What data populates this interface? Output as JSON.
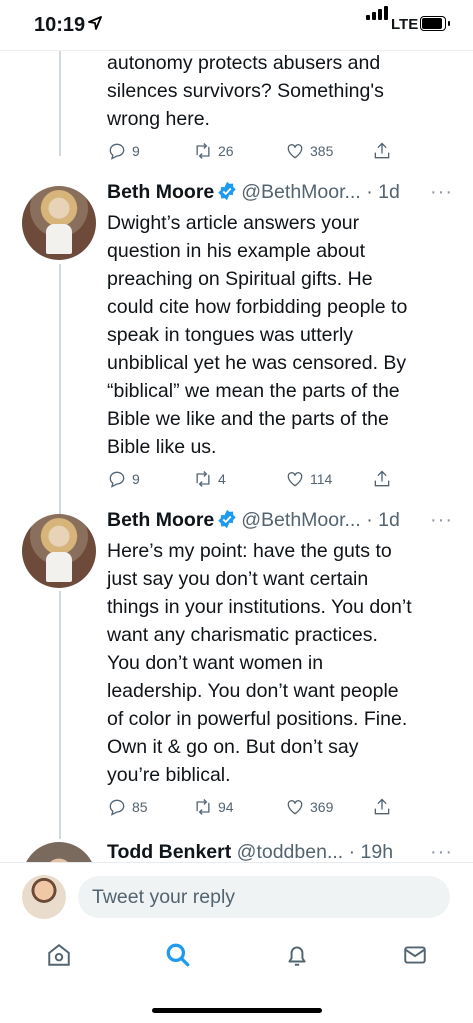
{
  "status_bar": {
    "time": "10:19",
    "network": "LTE"
  },
  "tweets": [
    {
      "text": "autonomy protects abusers and\nsilences survivors? Something's\nwrong here.",
      "replies": "9",
      "retweets": "26",
      "likes": "385"
    },
    {
      "name": "Beth Moore",
      "handle": "@BethMoor...",
      "time": "· 1d",
      "more": "···",
      "text": "Dwight’s article answers your\nquestion in his example about\npreaching on Spiritual gifts. He\ncould cite how forbidding people to\nspeak in tongues was utterly\nunbiblical yet he was censored. By\n“biblical” we mean the parts of the\nBible we like and the parts of the\nBible like us.",
      "replies": "9",
      "retweets": "4",
      "likes": "114"
    },
    {
      "name": "Beth Moore",
      "handle": "@BethMoor...",
      "time": "· 1d",
      "more": "···",
      "text": "Here’s my point: have the guts to\njust say you don’t want certain\nthings in your institutions. You don’t\nwant any charismatic practices.\nYou don’t want women in\nleadership. You don’t want people\nof color in powerful positions. Fine.\nOwn it & go on. But don’t say\nyou’re biblical.",
      "replies": "85",
      "retweets": "94",
      "likes": "369"
    },
    {
      "name": "Todd Benkert",
      "handle": "@toddben...",
      "time": "· 19h",
      "more": "···"
    }
  ],
  "reply_bar": {
    "placeholder": "Tweet your reply"
  },
  "tab_bar": [
    "home-icon",
    "search-icon",
    "notifications-icon",
    "messages-icon"
  ],
  "colors": {
    "accent": "#1d9bf0",
    "muted": "#536471",
    "verified": "#1d9bf0"
  }
}
